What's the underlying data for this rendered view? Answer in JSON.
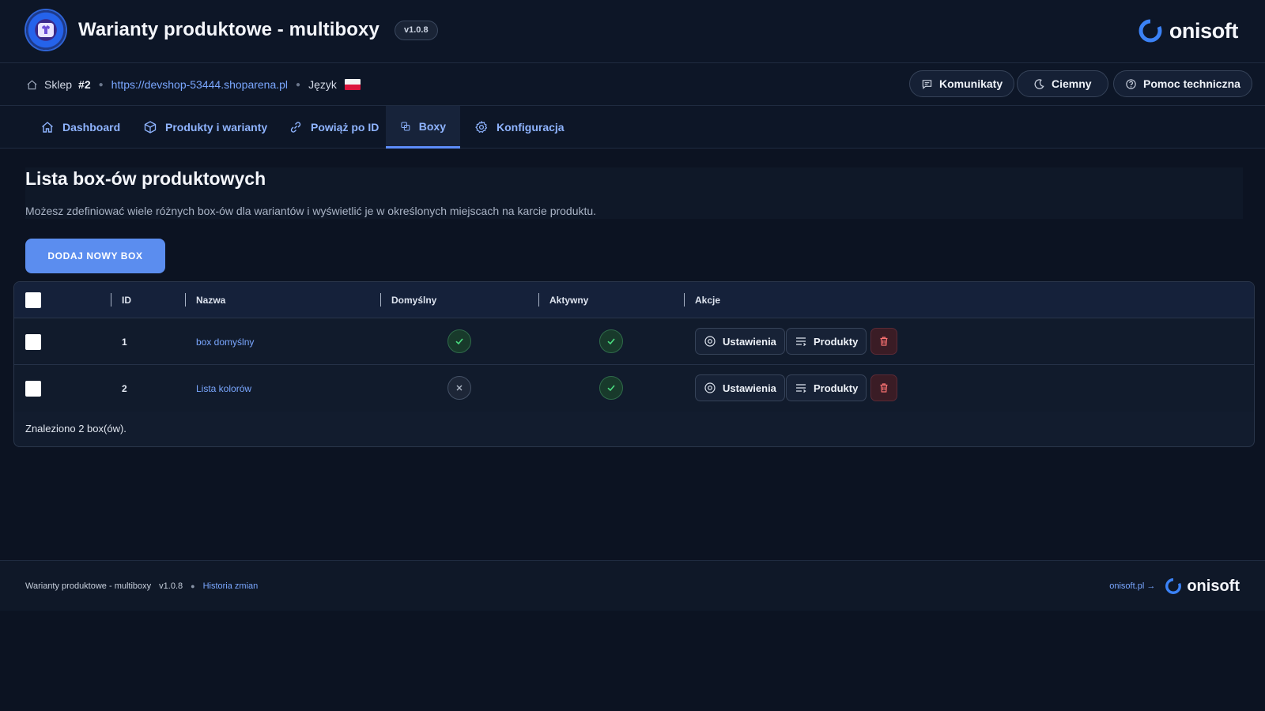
{
  "header": {
    "title": "Warianty produktowe - multiboxy",
    "version": "v1.0.8",
    "brand": "onisoft"
  },
  "shopbar": {
    "shop_label": "Sklep",
    "shop_number": "#2",
    "shop_url": "https://devshop-53444.shoparena.pl",
    "language_label": "Język",
    "buttons": {
      "messages": "Komunikaty",
      "theme": "Ciemny",
      "support": "Pomoc techniczna"
    }
  },
  "nav": {
    "tabs": [
      {
        "label": "Dashboard",
        "icon": "home-icon"
      },
      {
        "label": "Produkty i warianty",
        "icon": "box-icon"
      },
      {
        "label": "Powiąż po ID",
        "icon": "link-icon"
      },
      {
        "label": "Boxy",
        "icon": "copy-icon",
        "active": true
      },
      {
        "label": "Konfiguracja",
        "icon": "gear-icon"
      }
    ]
  },
  "main": {
    "title": "Lista box-ów produktowych",
    "description": "Możesz zdefiniować wiele różnych box-ów dla wariantów i wyświetlić je w określonych miejscach na karcie produktu.",
    "add_button": "DODAJ NOWY BOX"
  },
  "table": {
    "columns": {
      "id": "ID",
      "name": "Nazwa",
      "default": "Domyślny",
      "active": "Aktywny",
      "actions": "Akcje"
    },
    "rows": [
      {
        "id": "1",
        "name": "box domyślny",
        "default": true,
        "active": true
      },
      {
        "id": "2",
        "name": "Lista kolorów",
        "default": false,
        "active": true
      }
    ],
    "action_labels": {
      "settings": "Ustawienia",
      "products": "Produkty"
    },
    "footer": "Znaleziono 2 box(ów)."
  },
  "footer": {
    "app_name": "Warianty produktowe - multiboxy",
    "version": "v1.0.8",
    "changelog": "Historia zmian",
    "site_link": "onisoft.pl →",
    "brand": "onisoft"
  },
  "colors": {
    "background": "#0c1322",
    "accent": "#5b8def",
    "link": "#7aa7ff",
    "success": "#4ade80",
    "danger": "#f87171"
  }
}
